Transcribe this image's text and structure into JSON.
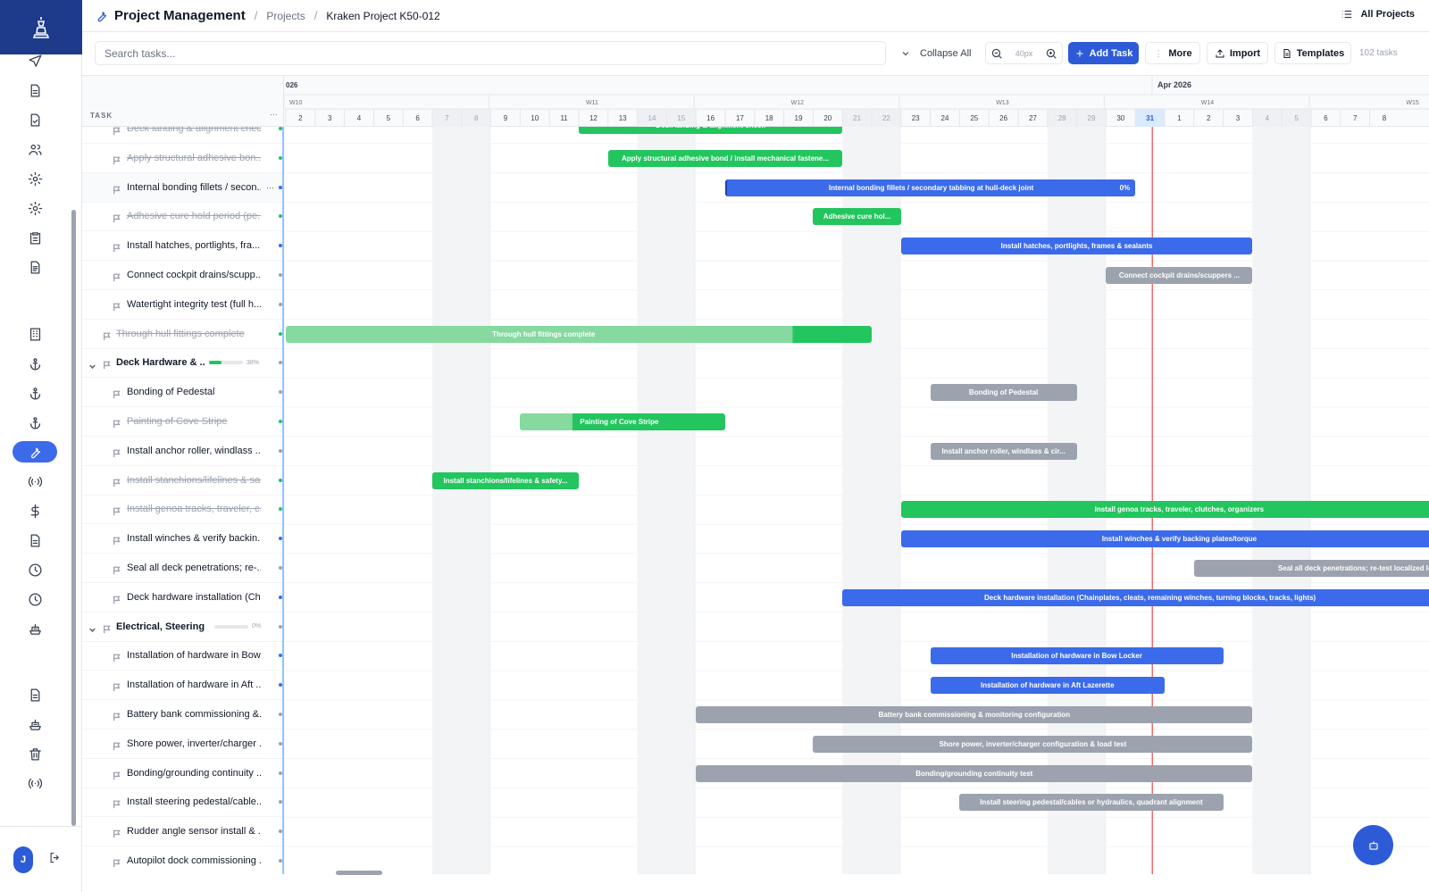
{
  "header": {
    "app_title": "Project Management",
    "breadcrumbs": [
      "Projects",
      "Kraken Project K50-012"
    ],
    "all_projects": "All Projects"
  },
  "toolbar": {
    "search_placeholder": "Search tasks...",
    "collapse_all": "Collapse All",
    "zoom": "40px",
    "add_task": "Add Task",
    "more": "More",
    "import": "Import",
    "templates": "Templates",
    "task_count": "102 tasks"
  },
  "timeline": {
    "task_header": "TASK",
    "month_labels": [
      "026",
      "Apr 2026"
    ],
    "week_labels": [
      "W10",
      "W11",
      "W12",
      "W13",
      "W14",
      "W15"
    ],
    "days": [
      "2",
      "3",
      "4",
      "5",
      "6",
      "7",
      "8",
      "9",
      "10",
      "11",
      "12",
      "13",
      "14",
      "15",
      "16",
      "17",
      "18",
      "19",
      "20",
      "21",
      "22",
      "23",
      "24",
      "25",
      "26",
      "27",
      "28",
      "29",
      "30",
      "31",
      "1",
      "2",
      "3",
      "4",
      "5",
      "6",
      "7",
      "8"
    ],
    "today": "31"
  },
  "user": {
    "initial": "J"
  },
  "sidebar_icons": [
    "logo-icon",
    "send-icon",
    "document-icon",
    "document-check-icon",
    "users-icon",
    "gear-icon",
    "gear-alt-icon",
    "clipboard-icon",
    "document-list-icon",
    "building-icon",
    "anchor-icon",
    "anchor-alt-icon",
    "anchor-third-icon",
    "wrench-icon",
    "broadcast-icon",
    "dollar-icon",
    "document-text-icon",
    "clock-icon",
    "clock-alt-icon",
    "ship-icon",
    "document-bottom-icon",
    "ship-alt-icon",
    "trash-icon",
    "broadcast-bottom-icon"
  ],
  "rows": [
    {
      "label": "Deck landing & alignment check",
      "type": "task",
      "done": true,
      "dot": "#22c55e"
    },
    {
      "label": "Apply structural adhesive bon...",
      "type": "task",
      "done": true,
      "dot": "#22c55e"
    },
    {
      "label": "Internal bonding fillets / secon...",
      "type": "task",
      "done": false,
      "dot": "#3b6bea",
      "selected": true
    },
    {
      "label": "Adhesive cure hold period (pe...",
      "type": "task",
      "done": true,
      "dot": "#22c55e"
    },
    {
      "label": "Install hatches, portlights, fra...",
      "type": "task",
      "done": false,
      "dot": "#3b6bea"
    },
    {
      "label": "Connect cockpit drains/scupp...",
      "type": "task",
      "done": false,
      "dot": "#9ca3af"
    },
    {
      "label": "Watertight integrity test (full h...",
      "type": "task",
      "done": false,
      "dot": "#9ca3af"
    },
    {
      "label": "Through hull fittings complete",
      "type": "milestone",
      "done": true,
      "dot": "#22c55e"
    },
    {
      "label": "Deck Hardware & ...",
      "type": "group",
      "progress": 38,
      "pct": "38%",
      "dot": "#9ca3af"
    },
    {
      "label": "Bonding of Pedestal",
      "type": "task",
      "done": false,
      "dot": "#9ca3af"
    },
    {
      "label": "Painting of Cove Stripe",
      "type": "task",
      "done": true,
      "dot": "#22c55e"
    },
    {
      "label": "Install anchor roller, windlass ...",
      "type": "task",
      "done": false,
      "dot": "#9ca3af"
    },
    {
      "label": "Install stanchions/lifelines & sa...",
      "type": "task",
      "done": true,
      "dot": "#22c55e"
    },
    {
      "label": "Install genoa tracks, traveler, c...",
      "type": "task",
      "done": true,
      "dot": "#22c55e"
    },
    {
      "label": "Install winches & verify backin...",
      "type": "task",
      "done": false,
      "dot": "#3b6bea"
    },
    {
      "label": "Seal all deck penetrations; re-...",
      "type": "task",
      "done": false,
      "dot": "#9ca3af"
    },
    {
      "label": "Deck hardware installation (Ch...",
      "type": "task",
      "done": false,
      "dot": "#3b6bea"
    },
    {
      "label": "Electrical, Steering ...",
      "type": "group",
      "progress": 0,
      "pct": "0%",
      "dot": "#9ca3af"
    },
    {
      "label": "Installation of hardware in Bow...",
      "type": "task",
      "done": false,
      "dot": "#3b6bea"
    },
    {
      "label": "Installation of hardware in Aft ...",
      "type": "task",
      "done": false,
      "dot": "#3b6bea"
    },
    {
      "label": "Battery bank commissioning &...",
      "type": "task",
      "done": false,
      "dot": "#9ca3af"
    },
    {
      "label": "Shore power, inverter/charger ...",
      "type": "task",
      "done": false,
      "dot": "#9ca3af"
    },
    {
      "label": "Bonding/grounding continuity ...",
      "type": "task",
      "done": false,
      "dot": "#9ca3af"
    },
    {
      "label": "Install steering pedestal/cable...",
      "type": "task",
      "done": false,
      "dot": "#9ca3af"
    },
    {
      "label": "Rudder angle sensor install & ...",
      "type": "task",
      "done": false,
      "dot": "#9ca3af"
    },
    {
      "label": "Autopilot dock commissioning ...",
      "type": "task",
      "done": false,
      "dot": "#9ca3af"
    }
  ],
  "bars": [
    {
      "row": 0,
      "start": 10,
      "end": 19,
      "label": "Deck landing & alignment check",
      "color": "green"
    },
    {
      "row": 1,
      "start": 11,
      "end": 19,
      "label": "Apply structural adhesive bond / install mechanical fastene...",
      "color": "green"
    },
    {
      "row": 2,
      "start": 15,
      "end": 29,
      "label": "Internal bonding fillets / secondary tabbing at hull-deck joint",
      "color": "blue",
      "progress": "0%"
    },
    {
      "row": 3,
      "start": 18,
      "end": 21,
      "label": "Adhesive cure hol...",
      "color": "green"
    },
    {
      "row": 4,
      "start": 21,
      "end": 33,
      "label": "Install hatches, portlights, frames & sealants",
      "color": "blue"
    },
    {
      "row": 5,
      "start": 28,
      "end": 33,
      "label": "Connect cockpit drains/scuppers ...",
      "color": "gray"
    },
    {
      "row": 7,
      "start": 0,
      "end": 20,
      "label": "Through hull fittings complete",
      "color": "green",
      "partial": 17.3
    },
    {
      "row": 9,
      "start": 22,
      "end": 27,
      "label": "Bonding of Pedestal",
      "color": "gray"
    },
    {
      "row": 10,
      "start": 8,
      "end": 15,
      "label": "Painting of Cove Stripe",
      "color": "green",
      "partial": 1.8
    },
    {
      "row": 11,
      "start": 22,
      "end": 27,
      "label": "Install anchor roller, windlass & cir...",
      "color": "gray"
    },
    {
      "row": 12,
      "start": 5,
      "end": 10,
      "label": "Install stanchions/lifelines & safety...",
      "color": "green"
    },
    {
      "row": 13,
      "start": 21,
      "end": 40,
      "label": "Install genoa tracks, traveler, clutches, organizers",
      "color": "green"
    },
    {
      "row": 14,
      "start": 21,
      "end": 40,
      "label": "Install winches & verify backing plates/torque",
      "color": "blue"
    },
    {
      "row": 15,
      "start": 31,
      "end": 42,
      "label": "Seal all deck penetrations; re-test localized le",
      "color": "gray"
    },
    {
      "row": 16,
      "start": 19,
      "end": 40,
      "label": "Deck hardware installation (Chainplates, cleats, remaining winches, turning blocks, tracks, lights)",
      "color": "blue"
    },
    {
      "row": 18,
      "start": 22,
      "end": 32,
      "label": "Installation of hardware in Bow Locker",
      "color": "blue"
    },
    {
      "row": 19,
      "start": 22,
      "end": 30,
      "label": "Installation of hardware in Aft Lazerette",
      "color": "blue"
    },
    {
      "row": 20,
      "start": 14,
      "end": 33,
      "label": "Battery bank commissioning & monitoring configuration",
      "color": "gray"
    },
    {
      "row": 21,
      "start": 18,
      "end": 33,
      "label": "Shore power, inverter/charger configuration & load test",
      "color": "gray"
    },
    {
      "row": 22,
      "start": 14,
      "end": 33,
      "label": "Bonding/grounding continuity test",
      "color": "gray"
    },
    {
      "row": 23,
      "start": 23,
      "end": 32,
      "label": "Install steering pedestal/cables or hydraulics, quadrant alignment",
      "color": "gray"
    }
  ],
  "colors": {
    "accent": "#2d5bd8",
    "green": "#22c55e",
    "blue": "#3b6bea",
    "gray": "#9ca3af",
    "today_line": "#ef4444"
  }
}
